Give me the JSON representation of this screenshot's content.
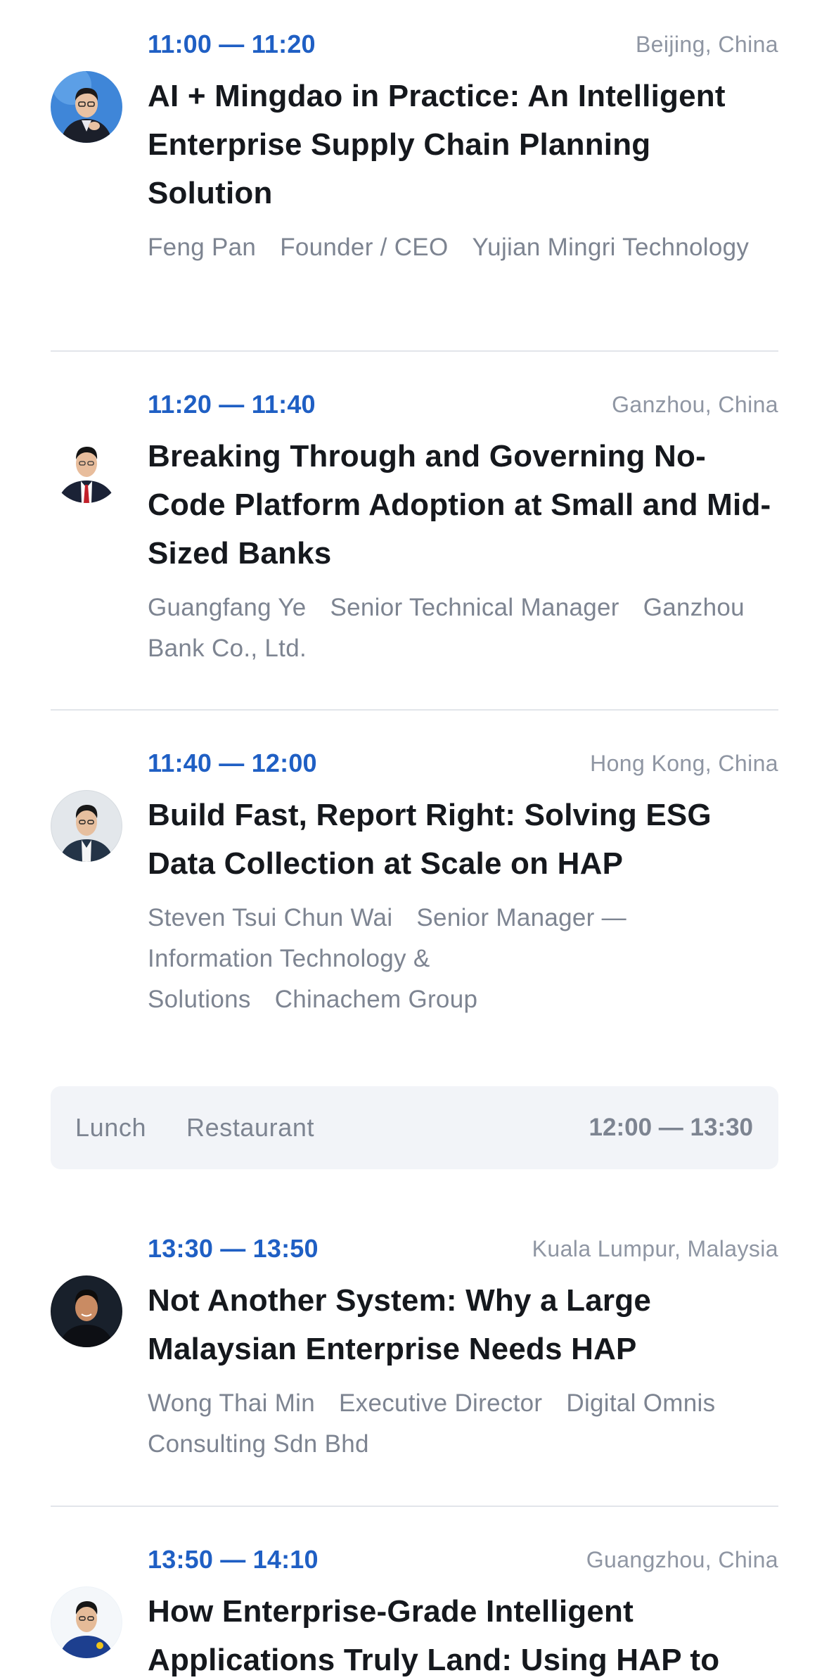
{
  "sessions": [
    {
      "time": "11:00 — 11:20",
      "location": "Beijing, China",
      "title": "AI + Mingdao in Practice: An Intelligent Enterprise Supply Chain Planning Solution",
      "speaker_name": "Feng Pan",
      "speaker_role": "Founder / CEO",
      "speaker_org": "Yujian Mingri Technology"
    },
    {
      "time": "11:20 — 11:40",
      "location": "Ganzhou, China",
      "title": "Breaking Through and Governing No-Code Platform Adoption at Small and Mid-Sized Banks",
      "speaker_name": "Guangfang Ye",
      "speaker_role": "Senior Technical Manager",
      "speaker_org": "Ganzhou Bank Co., Ltd."
    },
    {
      "time": "11:40 — 12:00",
      "location": "Hong Kong, China",
      "title": "Build Fast, Report Right: Solving ESG Data Collection at Scale on HAP",
      "speaker_name": "Steven Tsui Chun Wai",
      "speaker_role": "Senior Manager — Information Technology & Solutions",
      "speaker_org": "Chinachem Group"
    },
    {
      "time": "13:30 — 13:50",
      "location": "Kuala Lumpur, Malaysia",
      "title": "Not Another System: Why a Large Malaysian Enterprise Needs HAP",
      "speaker_name": "Wong Thai Min",
      "speaker_role": "Executive Director",
      "speaker_org": "Digital Omnis Consulting Sdn Bhd"
    },
    {
      "time": "13:50 — 14:10",
      "location": "Guangzhou, China",
      "title": "How Enterprise-Grade Intelligent Applications Truly Land: Using HAP to"
    }
  ],
  "break": {
    "label": "Lunch",
    "venue": "Restaurant",
    "time": "12:00 — 13:30"
  },
  "colors": {
    "time_accent": "#1f5fc4",
    "title_text": "#15181d",
    "muted_text": "#7d8491",
    "location_text": "#8f96a3",
    "divider": "#e2e5ea",
    "break_bg": "#f2f4f8"
  },
  "icons": [
    "avatar-feng-pan",
    "avatar-guangfang-ye",
    "avatar-steven-tsui",
    "avatar-wong-thai-min",
    "avatar-speaker-5"
  ]
}
